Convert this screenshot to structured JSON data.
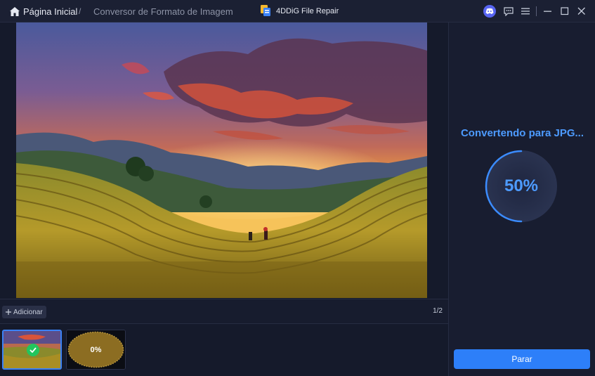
{
  "breadcrumb": {
    "home_label": "Página Inicial",
    "separator": "/",
    "current_label": "Conversor de Formato de Imagem"
  },
  "app": {
    "title": "4DDiG File Repair"
  },
  "window_controls": {
    "icons": [
      "discord-icon",
      "feedback-icon",
      "menu-icon",
      "minimize-icon",
      "maximize-icon",
      "close-icon"
    ]
  },
  "toolbar": {
    "add_label": "Adicionar",
    "page_counter": "1/2"
  },
  "thumbnails": [
    {
      "status": "done",
      "status_icon": "check-icon"
    },
    {
      "status": "processing",
      "percent_label": "0%"
    }
  ],
  "conversion": {
    "status_title": "Convertendo para JPG...",
    "percent_label": "50%",
    "progress": 0.5,
    "stop_label": "Parar"
  },
  "colors": {
    "accent": "#2d7ff9",
    "accent_text": "#4d9bff",
    "success": "#22c55e",
    "background": "#151a2b"
  }
}
